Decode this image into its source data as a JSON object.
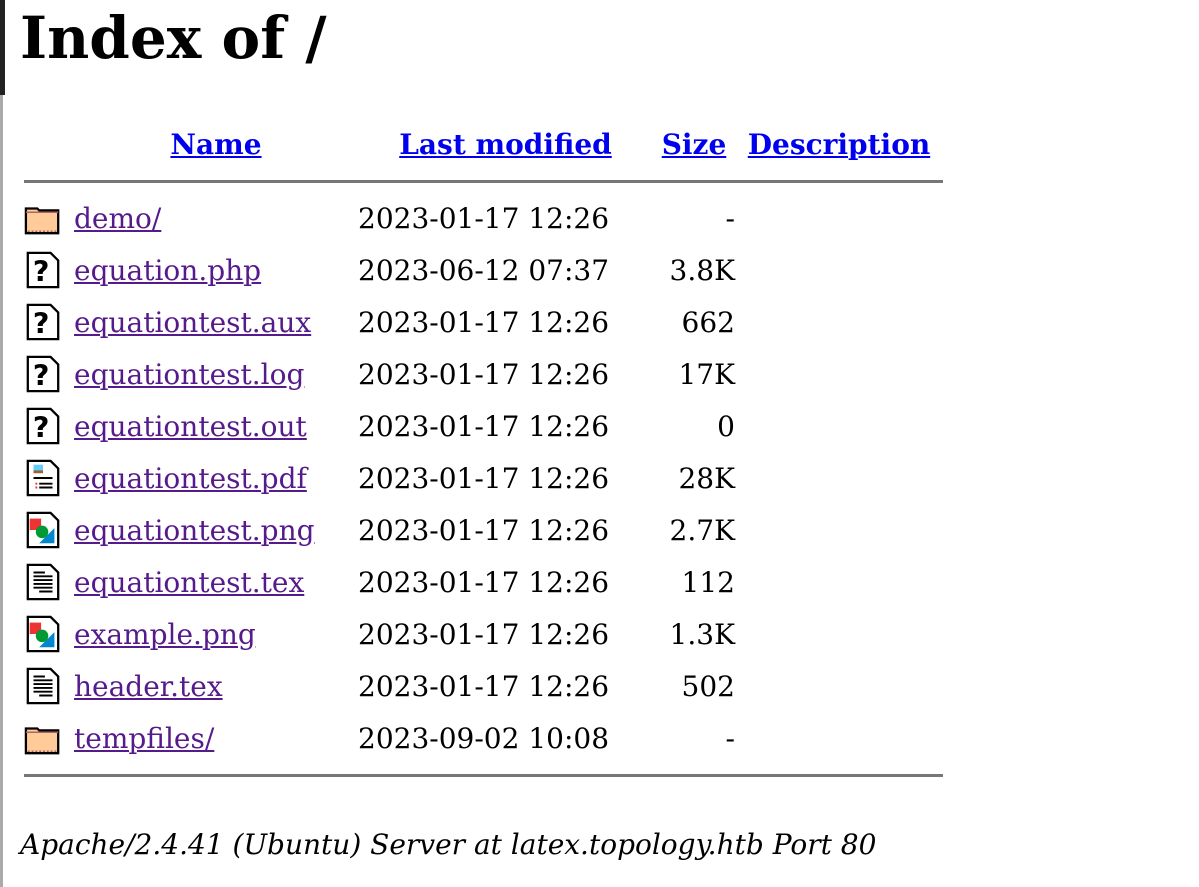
{
  "title": "Index of /",
  "headers": {
    "name": "Name",
    "modified": "Last modified",
    "size": "Size",
    "description": "Description"
  },
  "rows": [
    {
      "icon": "folder",
      "name": "demo/",
      "modified": "2023-01-17 12:26",
      "size": "-"
    },
    {
      "icon": "unknown",
      "name": "equation.php",
      "modified": "2023-06-12 07:37",
      "size": "3.8K"
    },
    {
      "icon": "unknown",
      "name": "equationtest.aux",
      "modified": "2023-01-17 12:26",
      "size": "662"
    },
    {
      "icon": "unknown",
      "name": "equationtest.log",
      "modified": "2023-01-17 12:26",
      "size": "17K"
    },
    {
      "icon": "unknown",
      "name": "equationtest.out",
      "modified": "2023-01-17 12:26",
      "size": "0"
    },
    {
      "icon": "layout",
      "name": "equationtest.pdf",
      "modified": "2023-01-17 12:26",
      "size": "28K"
    },
    {
      "icon": "image",
      "name": "equationtest.png",
      "modified": "2023-01-17 12:26",
      "size": "2.7K"
    },
    {
      "icon": "text",
      "name": "equationtest.tex",
      "modified": "2023-01-17 12:26",
      "size": "112"
    },
    {
      "icon": "image",
      "name": "example.png",
      "modified": "2023-01-17 12:26",
      "size": "1.3K"
    },
    {
      "icon": "text",
      "name": "header.tex",
      "modified": "2023-01-17 12:26",
      "size": "502"
    },
    {
      "icon": "folder",
      "name": "tempfiles/",
      "modified": "2023-09-02 10:08",
      "size": "-"
    }
  ],
  "footer": "Apache/2.4.41 (Ubuntu) Server at latex.topology.htb Port 80"
}
